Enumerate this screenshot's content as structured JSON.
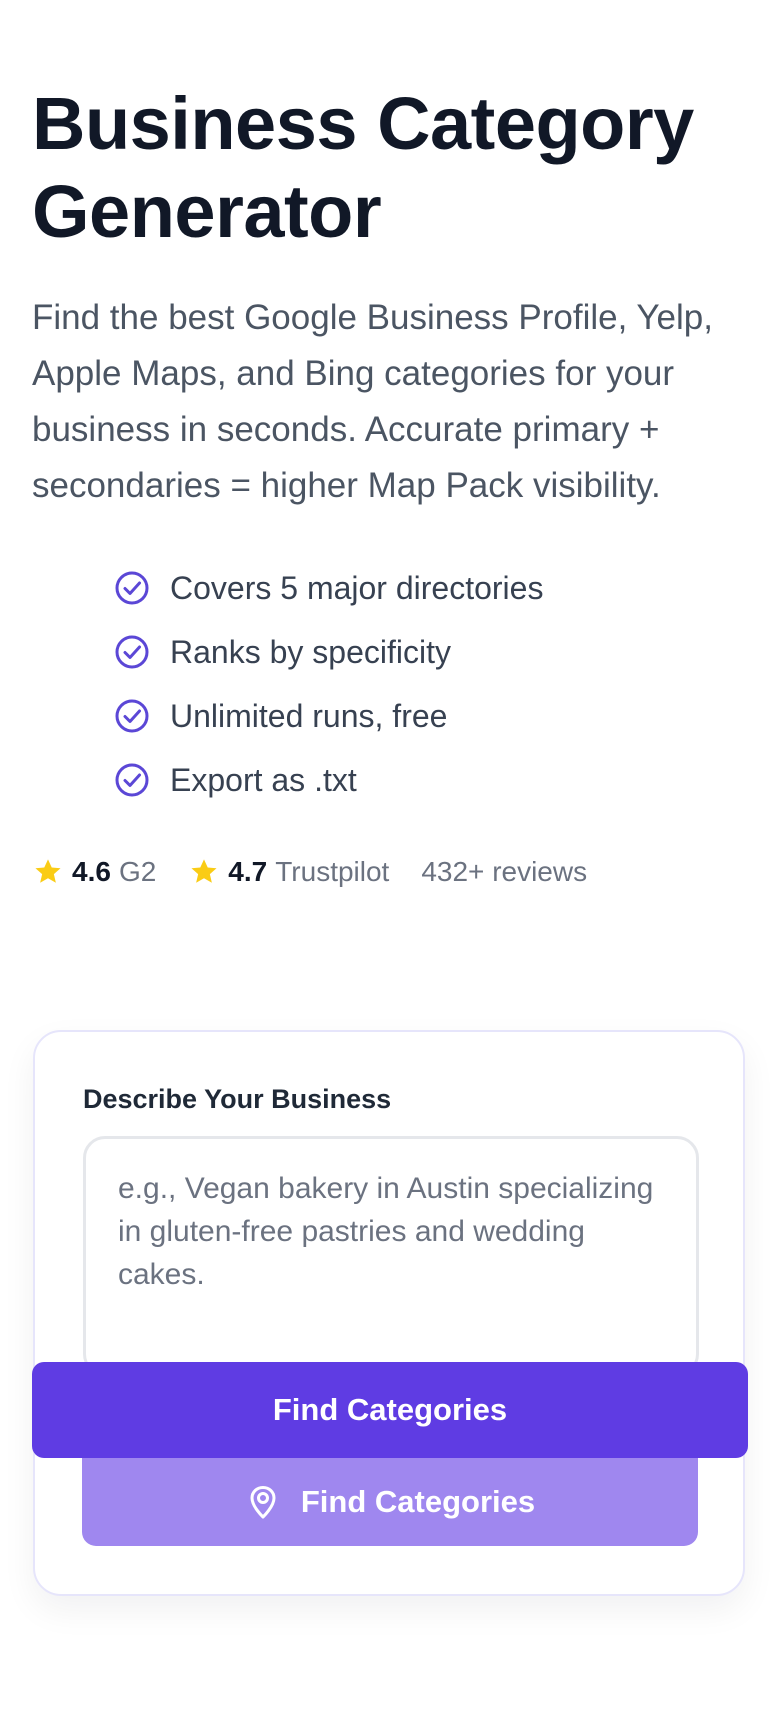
{
  "hero": {
    "title": "Business Category Generator",
    "description": "Find the best Google Business Profile, Yelp, Apple Maps, and Bing categories for your business in seconds. Accurate primary + secondaries = higher Map Pack visibility."
  },
  "features": [
    "Covers 5 major directories",
    "Ranks by specificity",
    "Unlimited runs, free",
    "Export as .txt"
  ],
  "ratings": {
    "g2": {
      "score": "4.6",
      "source": "G2"
    },
    "trustpilot": {
      "score": "4.7",
      "source": "Trustpilot"
    },
    "reviews": "432+ reviews"
  },
  "form": {
    "label": "Describe Your Business",
    "placeholder": "e.g., Vegan bakery in Austin specializing in gluten-free pastries and wedding cakes.",
    "value": "",
    "primary_button": "Find Categories",
    "secondary_button": "Find Categories"
  },
  "icons": {
    "feature": "check-circle-icon",
    "rating": "star-icon",
    "button": "map-pin-icon"
  },
  "colors": {
    "accent": "#5f3ce3",
    "accent_light": "#9f87ef",
    "star": "#facc15",
    "check": "#5b47d6",
    "title": "#111827"
  }
}
